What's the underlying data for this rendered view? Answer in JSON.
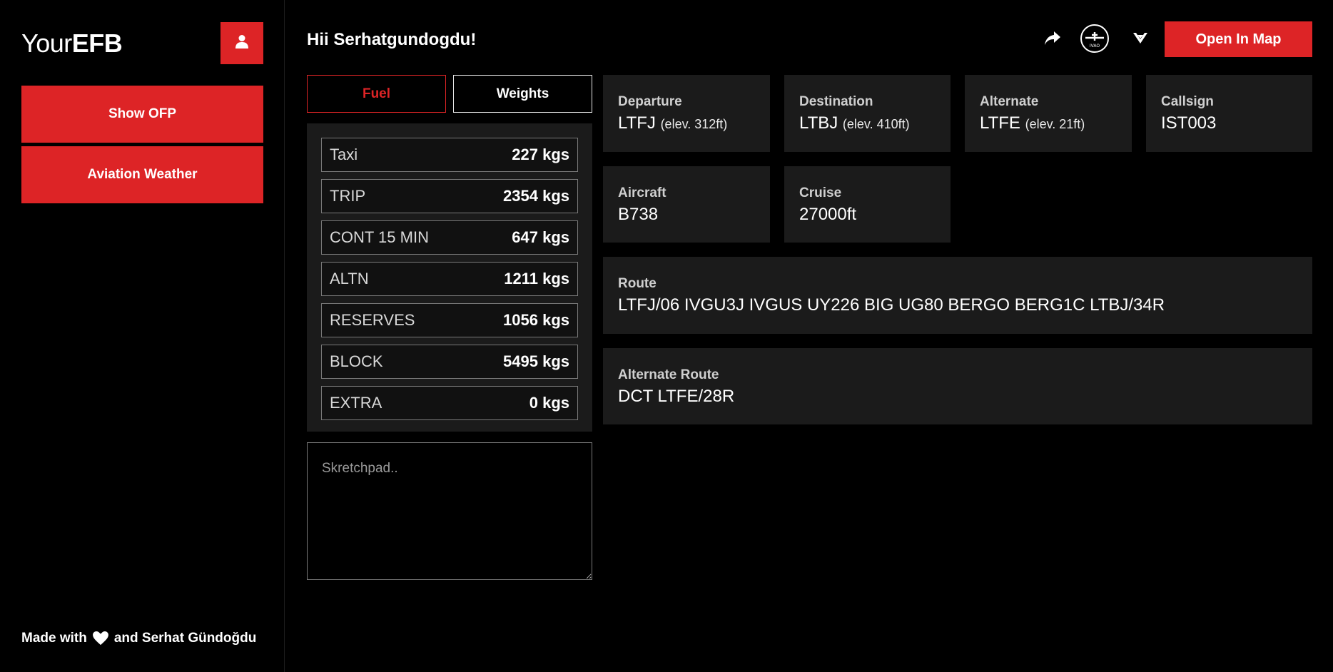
{
  "app": {
    "logo_light": "Your",
    "logo_bold": "EFB"
  },
  "sidebar": {
    "show_ofp": "Show OFP",
    "aviation_weather": "Aviation Weather",
    "footer_prefix": "Made with",
    "footer_suffix": "and Serhat Gündoğdu"
  },
  "header": {
    "greeting": "Hii Serhatgundogdu!",
    "open_in_map": "Open In Map"
  },
  "tabs": {
    "fuel": "Fuel",
    "weights": "Weights",
    "active": "fuel"
  },
  "fuel": [
    {
      "label": "Taxi",
      "value": "227 kgs"
    },
    {
      "label": "TRIP",
      "value": "2354 kgs"
    },
    {
      "label": "CONT 15 MIN",
      "value": "647 kgs"
    },
    {
      "label": "ALTN",
      "value": "1211 kgs"
    },
    {
      "label": "RESERVES",
      "value": "1056 kgs"
    },
    {
      "label": "BLOCK",
      "value": "5495 kgs"
    },
    {
      "label": "EXTRA",
      "value": "0 kgs"
    }
  ],
  "sketchpad": {
    "placeholder": "Skretchpad..",
    "value": ""
  },
  "flight": {
    "departure": {
      "label": "Departure",
      "code": "LTFJ",
      "elev": "(elev. 312ft)"
    },
    "destination": {
      "label": "Destination",
      "code": "LTBJ",
      "elev": "(elev. 410ft)"
    },
    "alternate": {
      "label": "Alternate",
      "code": "LTFE",
      "elev": "(elev. 21ft)"
    },
    "callsign": {
      "label": "Callsign",
      "value": "IST003"
    },
    "aircraft": {
      "label": "Aircraft",
      "value": "B738"
    },
    "cruise": {
      "label": "Cruise",
      "value": "27000ft"
    },
    "route": {
      "label": "Route",
      "value": "LTFJ/06 IVGU3J IVGUS UY226 BIG UG80 BERGO BERG1C LTBJ/34R"
    },
    "alternate_route": {
      "label": "Alternate Route",
      "value": "DCT LTFE/28R"
    }
  },
  "icons": {
    "user": "user-icon",
    "share": "share-icon",
    "ivao": "ivao-logo-icon",
    "vatsim": "vatsim-logo-icon",
    "heart": "heart-icon"
  },
  "colors": {
    "accent": "#dd2426",
    "background": "#000000",
    "panel": "#1b1b1b"
  }
}
